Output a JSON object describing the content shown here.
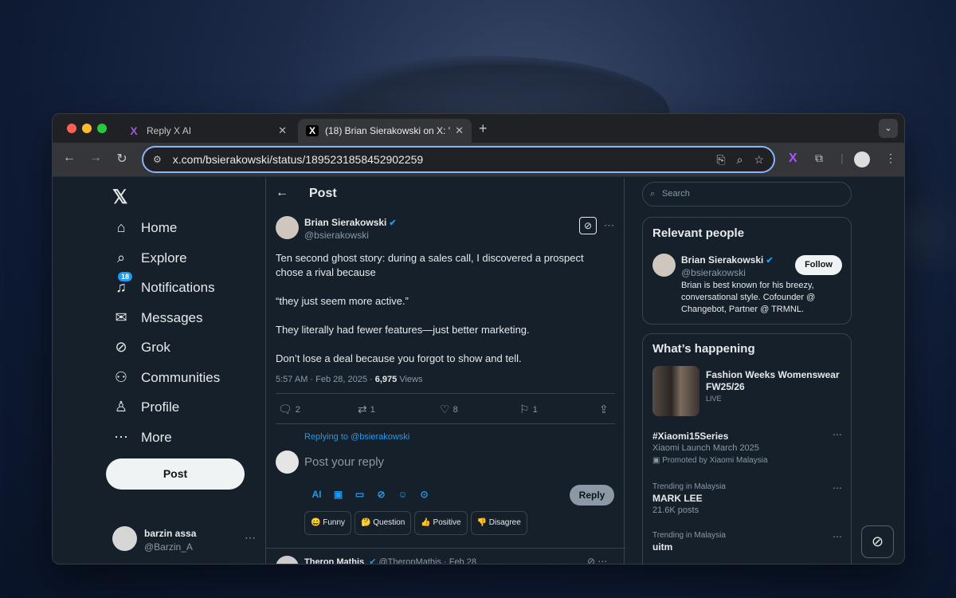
{
  "browser": {
    "tabs": [
      {
        "title": "Reply X AI",
        "icon": "X"
      },
      {
        "title": "(18) Brian Sierakowski on X: '",
        "icon": "X"
      }
    ],
    "url": "x.com/bsierakowski/status/1895231858452902259"
  },
  "nav": {
    "items": [
      {
        "label": "Home",
        "icon": "⌂"
      },
      {
        "label": "Explore",
        "icon": "⌕"
      },
      {
        "label": "Notifications",
        "icon": "♫",
        "badge": "18"
      },
      {
        "label": "Messages",
        "icon": "✉"
      },
      {
        "label": "Grok",
        "icon": "⊘"
      },
      {
        "label": "Communities",
        "icon": "⚇"
      },
      {
        "label": "Profile",
        "icon": "♙"
      },
      {
        "label": "More",
        "icon": "⋯"
      }
    ],
    "post_label": "Post",
    "user": {
      "name": "barzin assa",
      "handle": "@Barzin_A"
    }
  },
  "main": {
    "title": "Post",
    "tweet": {
      "author": "Brian Sierakowski",
      "handle": "@bsierakowski",
      "paragraphs": [
        "Ten second ghost story: during a sales call, I discovered a prospect chose a rival because",
        "“they just seem more active.”",
        "They literally had fewer features—just better marketing.",
        "Don’t lose a deal because you forgot to show and tell."
      ],
      "time": "5:57 AM · Feb 28, 2025 · ",
      "views_count": "6,975",
      "views_label": " Views",
      "replies": "2",
      "reposts": "1",
      "likes": "8",
      "bookmarks": "1"
    },
    "reply": {
      "replying_to_prefix": "Replying to ",
      "replying_to_handle": "@bsierakowski",
      "placeholder": "Post your reply",
      "button": "Reply",
      "chips": [
        "😄 Funny",
        "🤔 Question",
        "👍 Positive",
        "👎 Disagree"
      ]
    },
    "next_tweet": {
      "author": "Theron Mathis",
      "handle": "@TheronMathis",
      "date": "· Feb 28"
    }
  },
  "sidebar": {
    "search_placeholder": "Search",
    "relevant_title": "Relevant people",
    "relevant": {
      "name": "Brian Sierakowski",
      "handle": "@bsierakowski",
      "follow": "Follow",
      "bio": "Brian is best known for his breezy, conversational style. Cofounder @ Changebot, Partner @ TRMNL."
    },
    "happening_title": "What’s happening",
    "featured": {
      "title": "Fashion Weeks Womenswear FW25/26",
      "status": "LIVE"
    },
    "trends": [
      {
        "meta": "",
        "title": "#Xiaomi15Series",
        "sub": "Xiaomi Launch March 2025",
        "promo": "Promoted by Xiaomi Malaysia"
      },
      {
        "meta": "Trending in Malaysia",
        "title": "MARK LEE",
        "sub": "21.6K posts"
      },
      {
        "meta": "Trending in Malaysia",
        "title": "uitm",
        "sub": ""
      }
    ]
  }
}
